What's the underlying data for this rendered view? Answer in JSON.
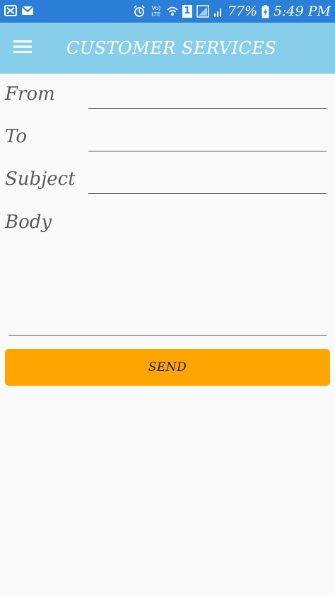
{
  "status_bar": {
    "network_label": "Vo) LTE",
    "sim_badge": "1",
    "battery_percent": "77%",
    "time": "5:49 PM",
    "background_color": "#2b7fd6"
  },
  "app_bar": {
    "title": "CUSTOMER SERVICES",
    "background_color": "#87ceeb",
    "menu_icon": "hamburger-menu-icon"
  },
  "form": {
    "from_label": "From",
    "from_value": "",
    "to_label": "To",
    "to_value": "",
    "subject_label": "Subject",
    "subject_value": "",
    "body_label": "Body",
    "body_value": ""
  },
  "send_button": {
    "label": "SEND",
    "background_color": "#ffa500"
  }
}
